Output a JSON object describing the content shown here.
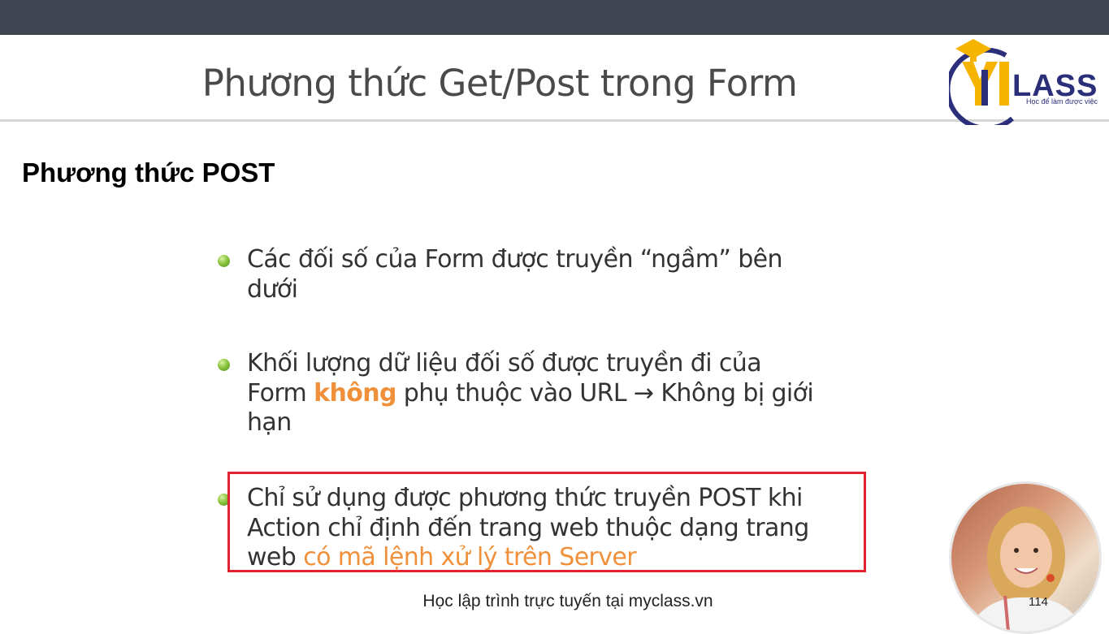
{
  "slide": {
    "title": "Phương thức Get/Post trong Form",
    "section_heading": "Phương thức POST",
    "bullets": [
      {
        "lines": [
          "Các đối số của Form được truyền “ngầm” bên",
          "dưới"
        ]
      },
      {
        "line1": "Khối lượng dữ liệu đối số được truyền đi của",
        "line2_prefix": "Form ",
        "line2_emphasis": "không",
        "line2_suffix": " phụ thuộc vào URL → Không bị giới",
        "line3": "hạn"
      },
      {
        "line1": "Chỉ sử dụng được phương thức truyền POST khi",
        "line2": "Action chỉ định đến trang web thuộc dạng trang",
        "line3_prefix": "web ",
        "line3_emphasis": "có mã lệnh xử lý trên Server"
      }
    ],
    "footer": "Học lập trình trực tuyến tại myclass.vn",
    "page_number": "114"
  },
  "logo": {
    "wordmark": "LASS",
    "tagline": "Học để làm được việc"
  },
  "colors": {
    "top_bar": "#3e4450",
    "emphasis": "#f0903a",
    "highlight_box": "#e0242f",
    "bullet": "#8cc63f"
  }
}
